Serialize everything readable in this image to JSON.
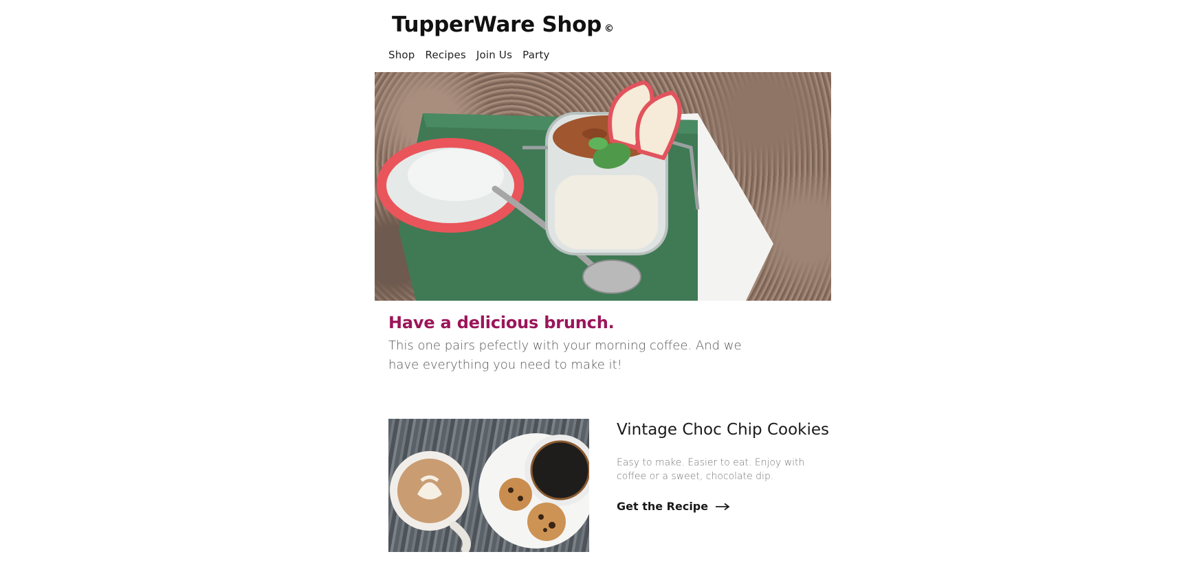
{
  "header": {
    "brand_title": "TupperWare Shop",
    "brand_mark": "©",
    "nav": [
      {
        "label": "Shop"
      },
      {
        "label": "Recipes"
      },
      {
        "label": "Join Us"
      },
      {
        "label": "Party"
      }
    ]
  },
  "hero": {
    "image_subject": "granola yogurt jar with apple slices on green napkin",
    "heading": "Have a delicious brunch.",
    "description": "This one pairs pefectly with your morning coffee. And we have everything you need to make it!"
  },
  "recipe_card": {
    "image_subject": "latte and black coffee with chocolate chip cookies",
    "title": "Vintage Choc Chip Cookies",
    "description": "Easy to make. Easier to eat. Enjoy with coffee or a sweet, chocolate dip.",
    "cta_label": "Get the Recipe",
    "cta_icon": "arrow-right-icon"
  },
  "colors": {
    "accent": "#9b1559",
    "text": "#1a1a1a",
    "muted": "#777777"
  }
}
